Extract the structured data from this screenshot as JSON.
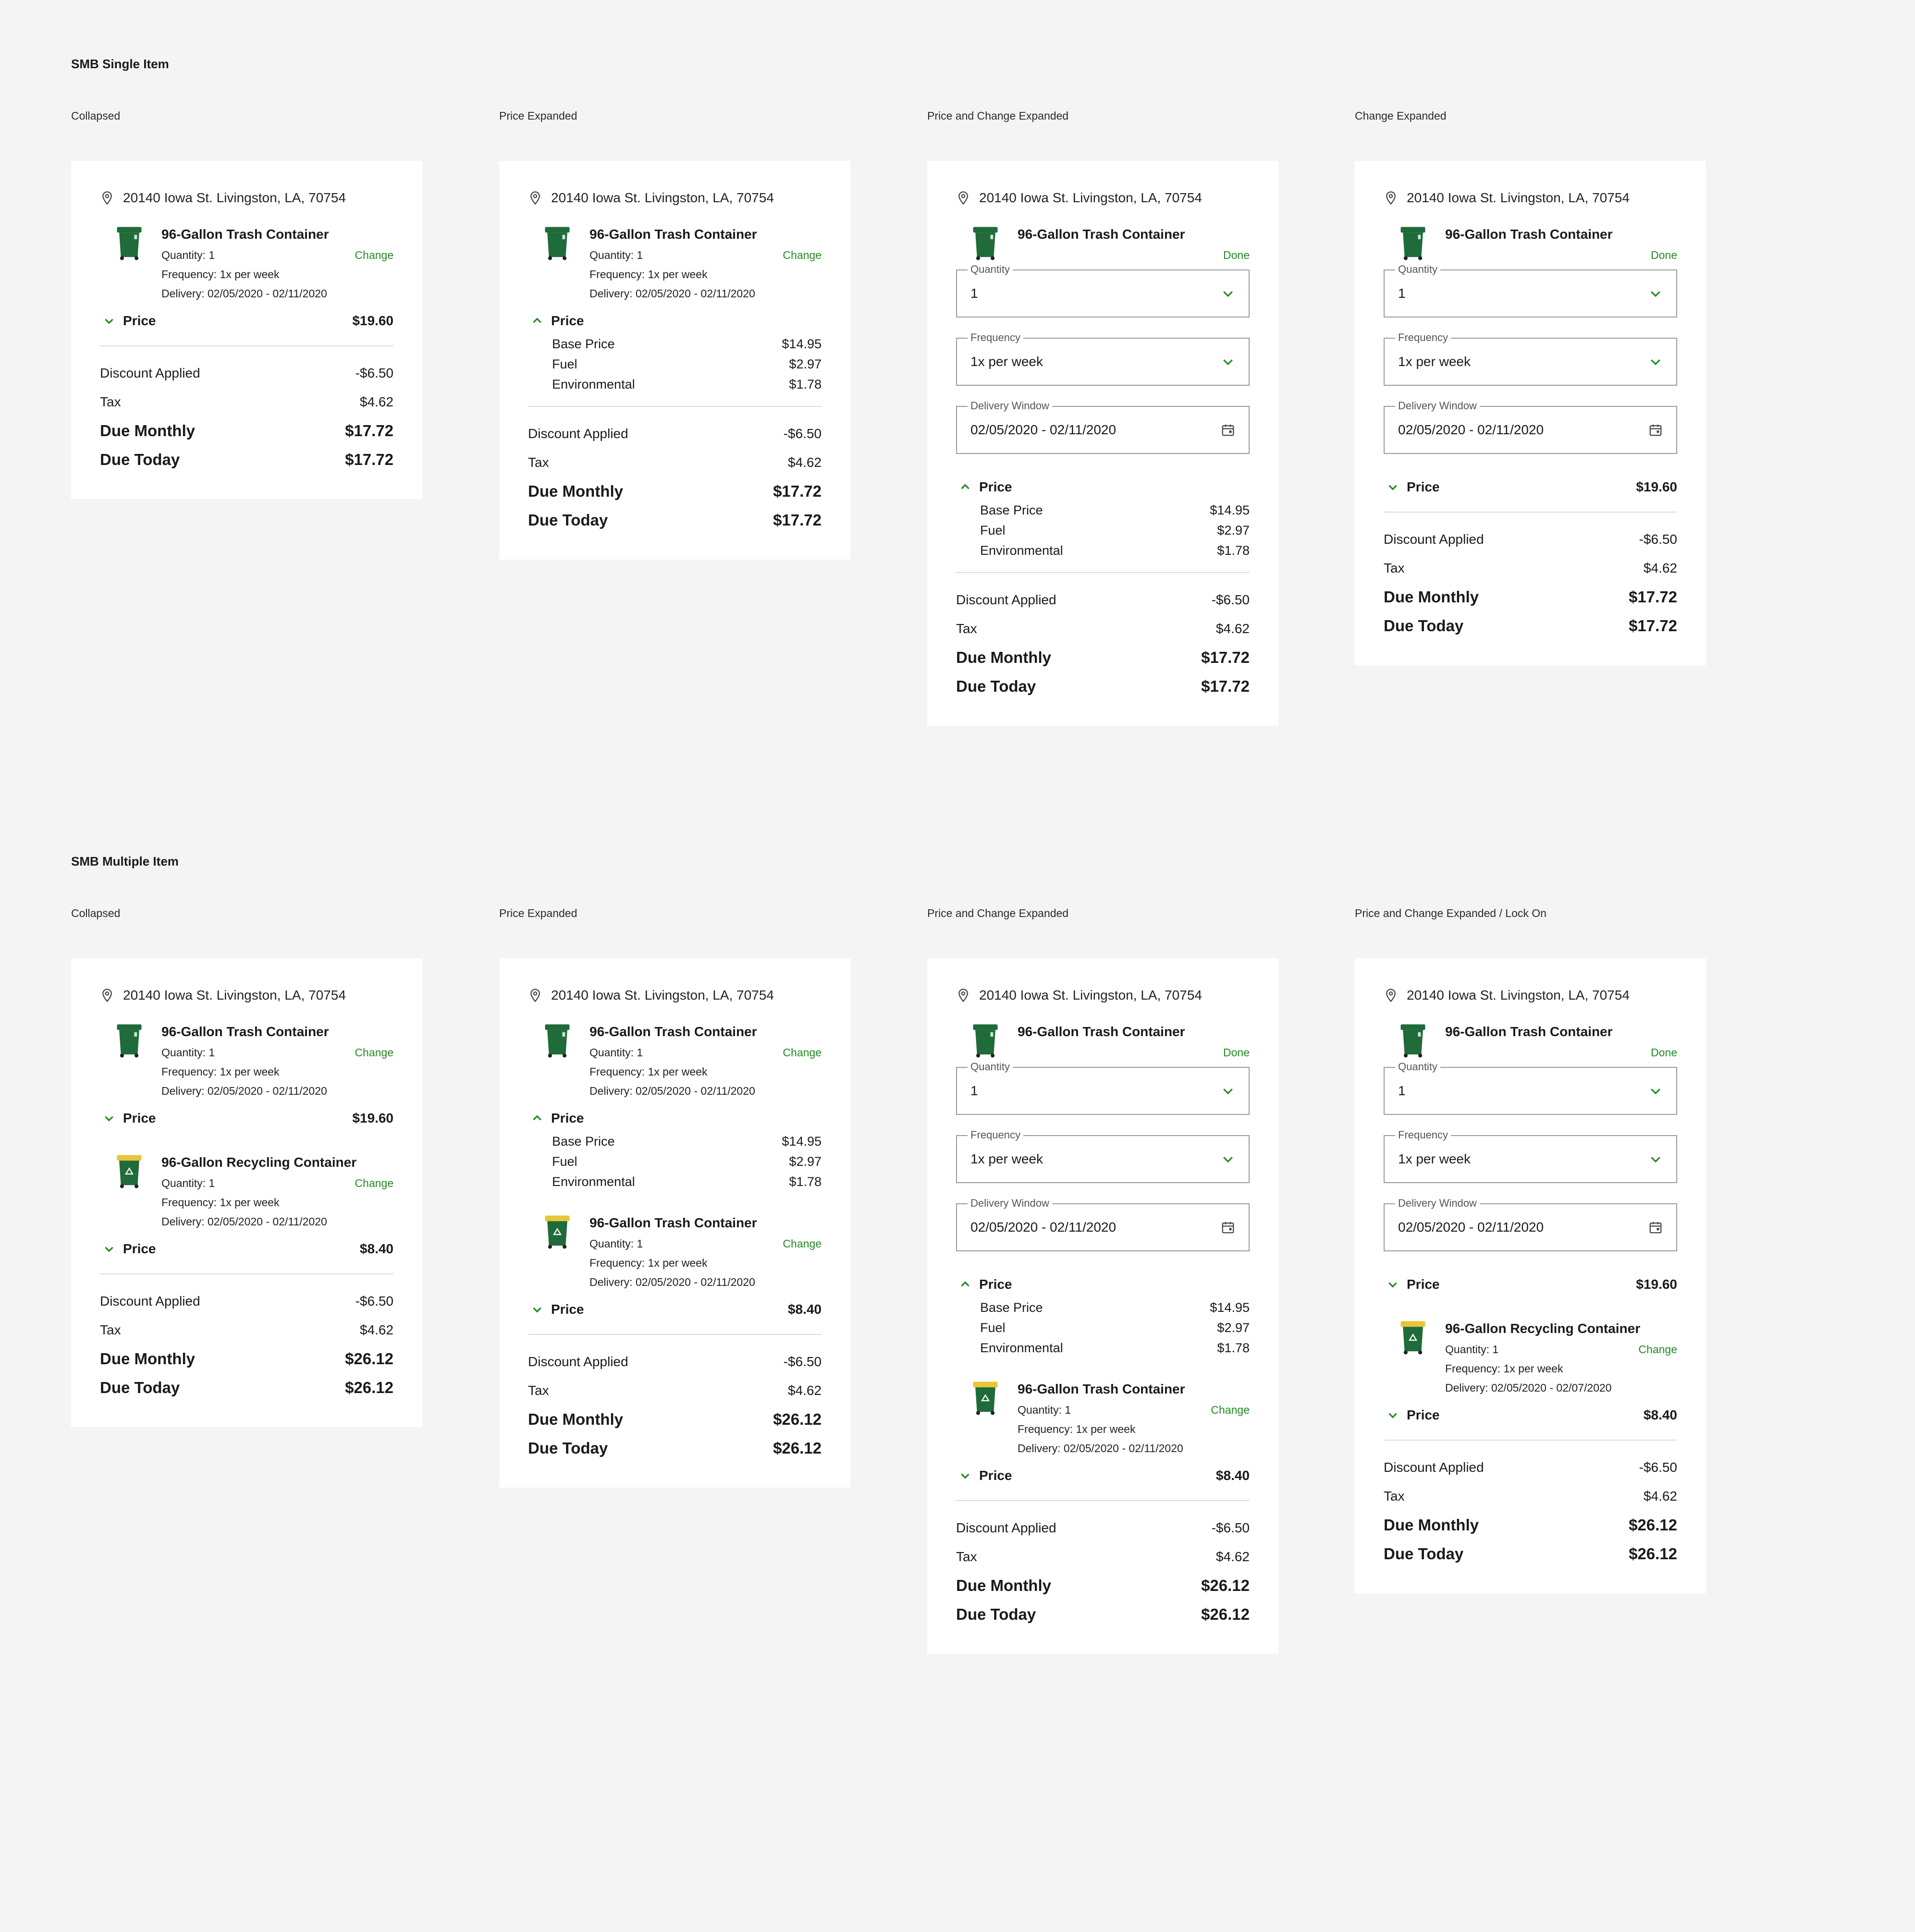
{
  "address": "20140 Iowa St. Livingston, LA, 70754",
  "item_trash": "96-Gallon Trash Container",
  "item_recycling": "96-Gallon Recycling Container",
  "meta": {
    "quantity": "Quantity: 1",
    "frequency": "Frequency: 1x per week",
    "delivery": "Delivery: 02/05/2020 - 02/11/2020",
    "delivery_alt": "Delivery: 02/05/2020 - 02/07/2020"
  },
  "actions": {
    "change": "Change",
    "done": "Done"
  },
  "fields": {
    "quantity_label": "Quantity",
    "quantity_value": "1",
    "frequency_label": "Frequency",
    "frequency_value": "1x per week",
    "window_label": "Delivery Window",
    "window_value": "02/05/2020 - 02/11/2020"
  },
  "price": {
    "label": "Price",
    "trash_total": "$19.60",
    "recycling_total": "$8.40",
    "base_label": "Base Price",
    "base_value": "$14.95",
    "fuel_label": "Fuel",
    "fuel_value": "$2.97",
    "env_label": "Environmental",
    "env_value": "$1.78"
  },
  "summary": {
    "discount_label": "Discount Applied",
    "discount_value": "-$6.50",
    "tax_label": "Tax",
    "tax_value": "$4.62",
    "monthly_label": "Due Monthly",
    "today_label": "Due Today",
    "single_total": "$17.72",
    "multi_total": "$26.12"
  },
  "sections": {
    "single": "SMB Single Item",
    "multiple": "SMB Multiple Item"
  },
  "card_labels": {
    "collapsed": "Collapsed",
    "price_expanded": "Price Expanded",
    "price_change_expanded": "Price and Change Expanded",
    "change_expanded": "Change Expanded",
    "lock_on": "Price and Change Expanded / Lock On"
  },
  "colors": {
    "accent": "#218b21",
    "bin_green": "#1f6b3a",
    "lid_yellow": "#e8c53a",
    "background": "#f4f4f4"
  }
}
